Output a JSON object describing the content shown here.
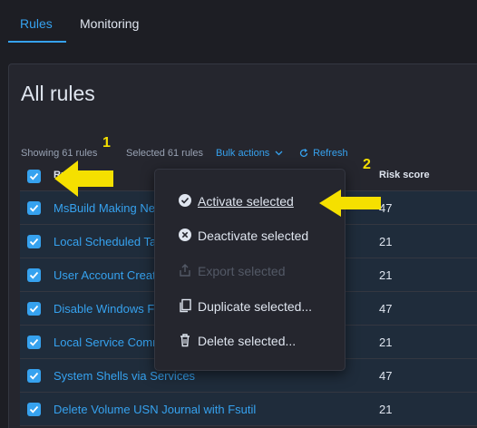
{
  "tabs": [
    {
      "label": "Rules",
      "active": true
    },
    {
      "label": "Monitoring",
      "active": false
    }
  ],
  "page_title": "All rules",
  "utility_bar": {
    "showing": "Showing 61 rules",
    "selected": "Selected 61 rules",
    "bulk_actions": "Bulk actions",
    "refresh": "Refresh"
  },
  "columns": {
    "rule": "Rule",
    "risk_score": "Risk score"
  },
  "rows": [
    {
      "name": "MsBuild Making Network Connections",
      "risk": "47"
    },
    {
      "name": "Local Scheduled Task Commands",
      "risk": "21"
    },
    {
      "name": "User Account Creation",
      "risk": "21"
    },
    {
      "name": "Disable Windows Firewall Rules via Netsh",
      "risk": "47"
    },
    {
      "name": "Local Service Commands",
      "risk": "21"
    },
    {
      "name": "System Shells via Services",
      "risk": "47"
    },
    {
      "name": "Delete Volume USN Journal with Fsutil",
      "risk": "21"
    }
  ],
  "bulk_menu": {
    "activate": "Activate selected",
    "deactivate": "Deactivate selected",
    "export": "Export selected",
    "duplicate": "Duplicate selected...",
    "delete": "Delete selected..."
  },
  "annotations": {
    "step1": "1",
    "step2": "2"
  },
  "colors": {
    "accent": "#36a2ef",
    "annotation": "#f5e000",
    "background": "#1d1e24",
    "panel": "#25262e",
    "selected_row": "#1f2c3b"
  }
}
